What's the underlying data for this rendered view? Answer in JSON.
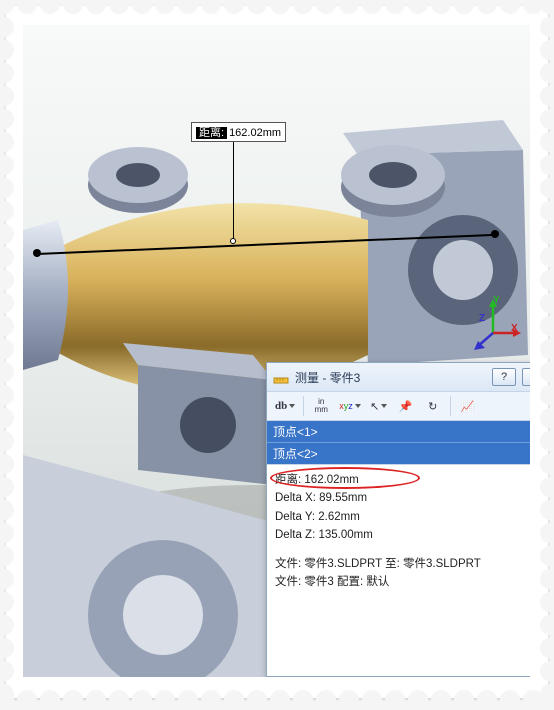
{
  "callout": {
    "label": "距离:",
    "value": "162.02mm"
  },
  "axes": {
    "x": "X",
    "y": "Y",
    "z": "Z"
  },
  "dialog": {
    "title": "测量 - 零件3",
    "help_label": "?",
    "close_label": "✕",
    "toolbar": {
      "arc_icon": "db",
      "unit_top": "in",
      "unit_bottom": "mm",
      "xyz_icon": "xyz",
      "pointer_icon": "↖",
      "pin_icon": "📌",
      "sync_icon": "↻",
      "chart_icon": "📈"
    },
    "selection": {
      "items": [
        "顶点<1>",
        "顶点<2>"
      ]
    },
    "results": {
      "distance_label": "距离:",
      "distance_value": "162.02mm",
      "delta_x_label": "Delta X:",
      "delta_x_value": "89.55mm",
      "delta_y_label": "Delta Y:",
      "delta_y_value": "2.62mm",
      "delta_z_label": "Delta Z:",
      "delta_z_value": "135.00mm",
      "file_line": "文件: 零件3.SLDPRT 至: 零件3.SLDPRT",
      "config_line": "文件: 零件3 配置: 默认"
    }
  }
}
